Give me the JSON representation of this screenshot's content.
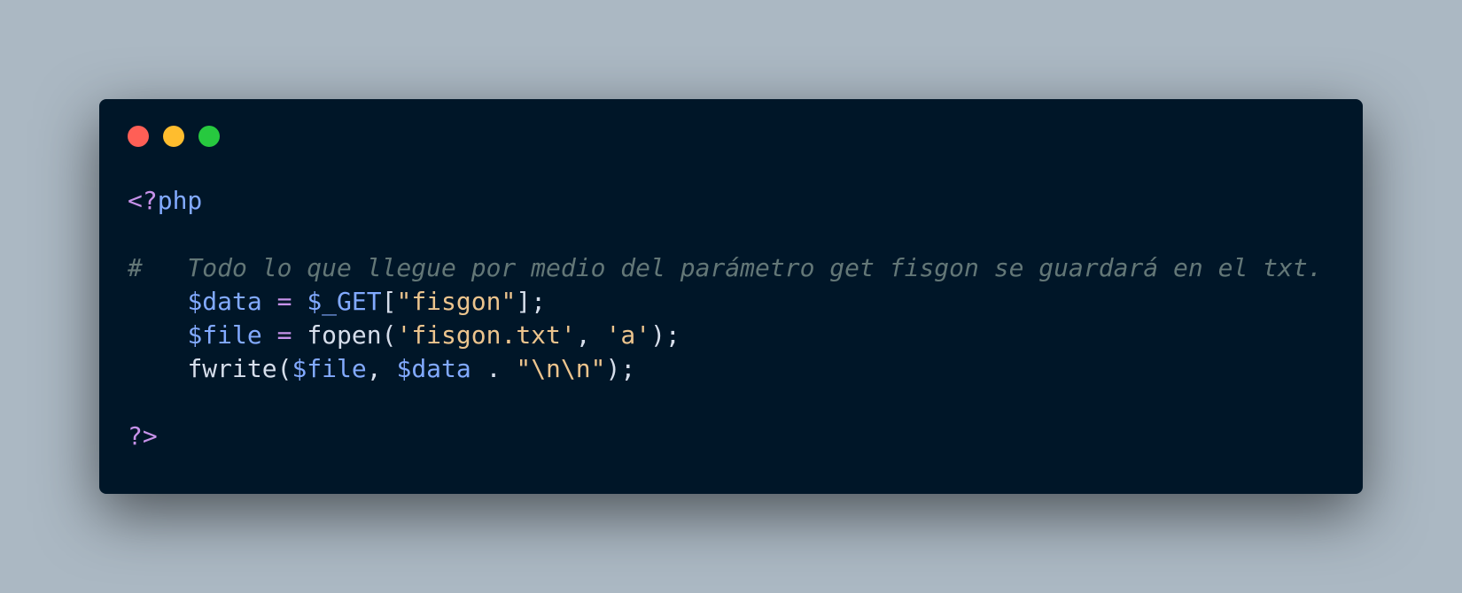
{
  "window": {
    "controls": [
      {
        "name": "close",
        "color": "#ff5f56"
      },
      {
        "name": "minimize",
        "color": "#ffbd2e"
      },
      {
        "name": "zoom",
        "color": "#27c93f"
      }
    ]
  },
  "colors": {
    "background": "#abb8c3",
    "window": "#001628",
    "default": "#d6deeb",
    "tag": "#c792ea",
    "variable": "#82aaff",
    "operator": "#c792ea",
    "string": "#ecc48d",
    "comment": "#637777",
    "function": "#d6deeb",
    "punct": "#d6deeb",
    "plain": "#d6deeb"
  },
  "code": {
    "language": "php",
    "lines": [
      [
        {
          "t": "tag",
          "v": "<?"
        },
        {
          "t": "variable",
          "v": "php"
        }
      ],
      [],
      [
        {
          "t": "comment",
          "v": "#   Todo lo que llegue por medio del parámetro get fisgon se guardará en el txt."
        }
      ],
      [
        {
          "t": "plain",
          "v": "    "
        },
        {
          "t": "variable",
          "v": "$data"
        },
        {
          "t": "plain",
          "v": " "
        },
        {
          "t": "operator",
          "v": "="
        },
        {
          "t": "plain",
          "v": " "
        },
        {
          "t": "variable",
          "v": "$_GET"
        },
        {
          "t": "punct",
          "v": "["
        },
        {
          "t": "string",
          "v": "\"fisgon\""
        },
        {
          "t": "punct",
          "v": "];"
        }
      ],
      [
        {
          "t": "plain",
          "v": "    "
        },
        {
          "t": "variable",
          "v": "$file"
        },
        {
          "t": "plain",
          "v": " "
        },
        {
          "t": "operator",
          "v": "="
        },
        {
          "t": "plain",
          "v": " "
        },
        {
          "t": "function",
          "v": "fopen"
        },
        {
          "t": "punct",
          "v": "("
        },
        {
          "t": "string",
          "v": "'fisgon.txt'"
        },
        {
          "t": "punct",
          "v": ", "
        },
        {
          "t": "string",
          "v": "'a'"
        },
        {
          "t": "punct",
          "v": ");"
        }
      ],
      [
        {
          "t": "plain",
          "v": "    "
        },
        {
          "t": "function",
          "v": "fwrite"
        },
        {
          "t": "punct",
          "v": "("
        },
        {
          "t": "variable",
          "v": "$file"
        },
        {
          "t": "punct",
          "v": ", "
        },
        {
          "t": "variable",
          "v": "$data"
        },
        {
          "t": "plain",
          "v": " . "
        },
        {
          "t": "string",
          "v": "\"\\n\\n\""
        },
        {
          "t": "punct",
          "v": ");"
        }
      ],
      [],
      [
        {
          "t": "tag",
          "v": "?>"
        }
      ]
    ]
  }
}
